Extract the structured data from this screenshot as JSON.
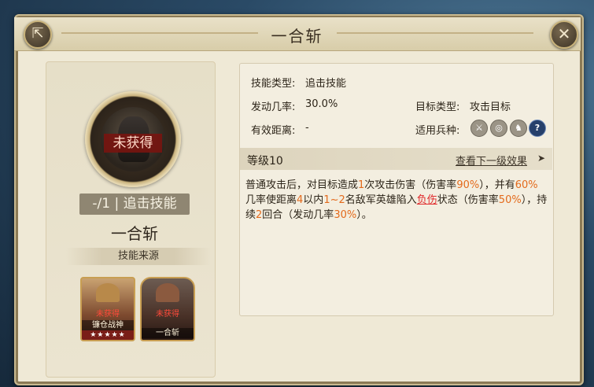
{
  "window": {
    "title": "一合斩"
  },
  "left_panel": {
    "status_label": "未获得",
    "skill_type_line": "-/1 | 追击技能",
    "skill_name": "一合斩",
    "source_heading": "技能来源",
    "sources": [
      {
        "status": "未获得",
        "name": "镰仓战神",
        "stars": "★★★★★"
      },
      {
        "status": "未获得",
        "name": "一合斩"
      }
    ]
  },
  "details": {
    "skill_type_label": "技能类型:",
    "skill_type_value": "追击技能",
    "trigger_rate_label": "发动几率:",
    "trigger_rate_value": "30.0%",
    "target_type_label": "目标类型:",
    "target_type_value": "攻击目标",
    "range_label": "有效距离:",
    "range_value": "-",
    "troop_label": "适用兵种:",
    "troop_icons": [
      "sword-icon",
      "target-icon",
      "horse-icon",
      "question-icon"
    ]
  },
  "level": {
    "label": "等级10",
    "next_link": "查看下一级效果",
    "arrow": "➤"
  },
  "description": {
    "p1": "普通攻击后，对目标造成",
    "n1": "1",
    "p2": "次攻击伤害（伤害率",
    "n2": "90%",
    "p3": "），并有",
    "n3": "60%",
    "p4": "几率使距离",
    "n4": "4",
    "p5": "以内",
    "n5": "1~2",
    "p6": "名敌军英雄陷入",
    "status": "负伤",
    "p7": "状态（伤害率",
    "n6": "50%",
    "p8": "），持续",
    "n7": "2",
    "p9": "回合（发动几率",
    "n8": "30%",
    "p10": "）。"
  },
  "colors": {
    "highlight": "#e36a1c",
    "status": "#e0282a",
    "panel": "#efe9d6"
  }
}
